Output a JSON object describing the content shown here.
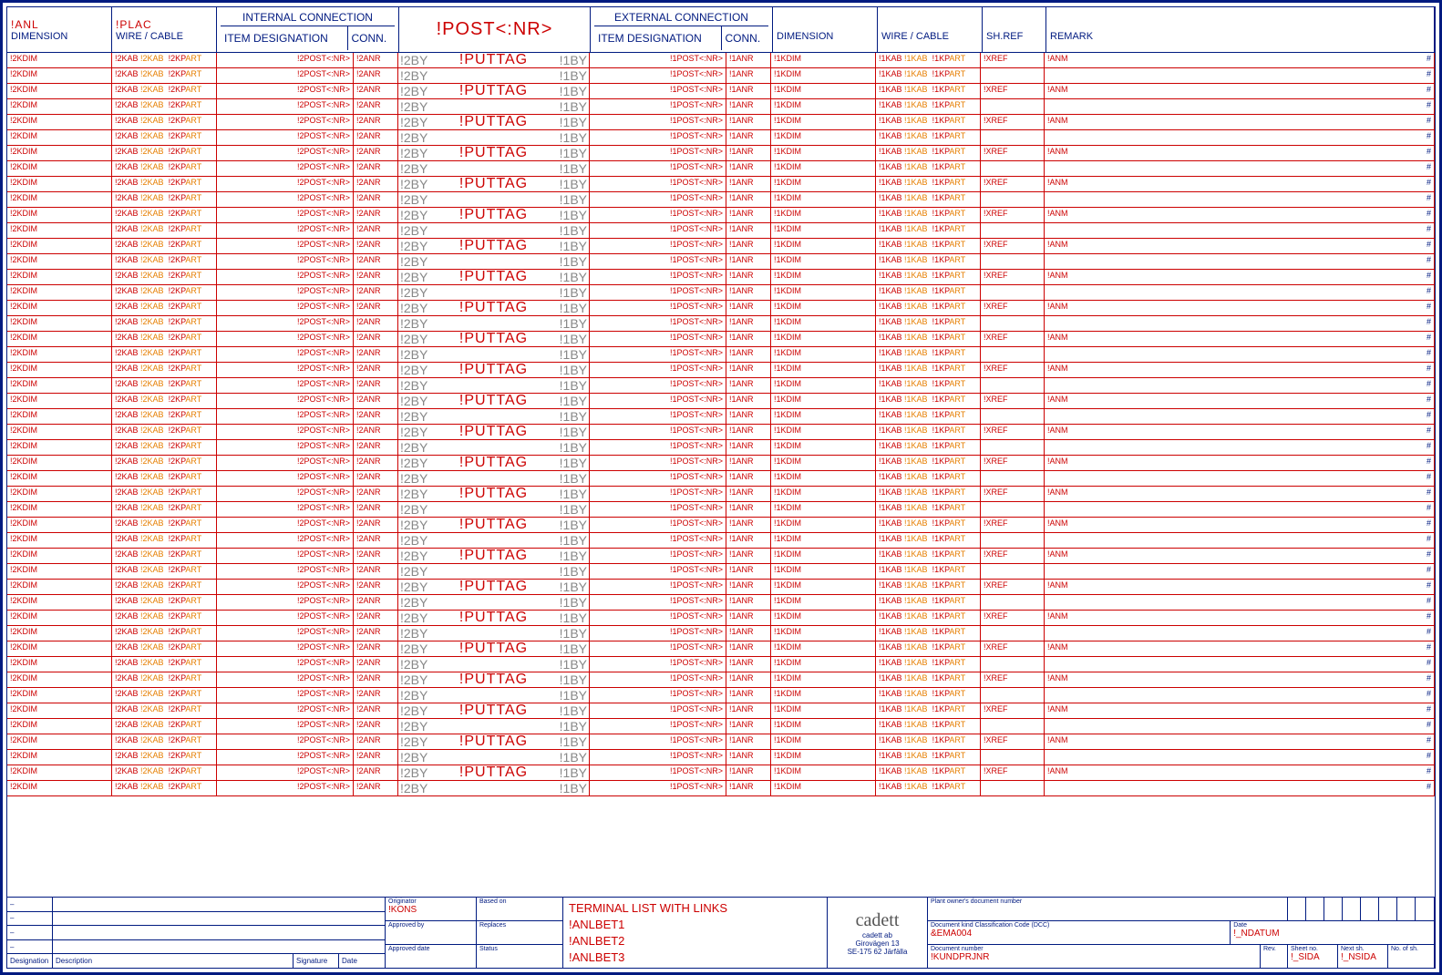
{
  "header": {
    "anl": "!ANL",
    "dimension_l": "DIMENSION",
    "plac": "!PLAC",
    "wire_cable_l": "WIRE / CABLE",
    "internal": "INTERNAL CONNECTION",
    "item_desig_l": "ITEM DESIGNATION",
    "conn_l": "CONN.",
    "post_nr": "!POST<:NR>",
    "external": "EXTERNAL CONNECTION",
    "item_desig_r": "ITEM DESIGNATION",
    "conn_r": "CONN.",
    "dimension_r": "DIMENSION",
    "wire_cable_r": "WIRE / CABLE",
    "shref": "SH.REF",
    "remark": "REMARK"
  },
  "cell": {
    "dim2": "!2KDIM",
    "kab2a": "!2KAB",
    "kab2b": "!2KAB",
    "kpart2": "!2KPART",
    "post2": "!2POST<:NR>",
    "anr2": "!2ANR",
    "by_l": "!2BY",
    "puttag": "!PUTTAG",
    "by_r": "!1BY",
    "post1": "!1POST<:NR>",
    "anr1": "!1ANR",
    "dim1": "!1KDIM",
    "kab1a": "!1KAB",
    "kab1b": "!1KAB",
    "kpart1": "!1KPART",
    "xref": "!XREF",
    "anm": "!ANM",
    "hash": "#"
  },
  "row_count": 48,
  "titleblock": {
    "left_rows": [
      [
        "–"
      ],
      [
        "–"
      ],
      [
        "–"
      ],
      [
        "–"
      ]
    ],
    "left_footer": [
      "Designation",
      "Description",
      "",
      "Signature",
      "Date"
    ],
    "mid1": [
      {
        "lbl": "Originator",
        "val": "!KONS"
      },
      {
        "lbl": "Approved by",
        "val": ""
      },
      {
        "lbl": "Approved date",
        "val": ""
      }
    ],
    "mid2": [
      {
        "lbl": "Based on",
        "val": ""
      },
      {
        "lbl": "Replaces",
        "val": ""
      },
      {
        "lbl": "Status",
        "val": ""
      }
    ],
    "title_lines": [
      "TERMINAL LIST WITH LINKS",
      "!ANLBET1",
      "!ANLBET2",
      "!ANLBET3"
    ],
    "company": {
      "name": "cadett",
      "sub1": "cadett ab",
      "sub2": "Girovägen 13",
      "sub3": "SE-175 62 Järfälla"
    },
    "right": {
      "plant_owner_lbl": "Plant owner's document number",
      "dcc_lbl": "Document kind Classification Code (DCC)",
      "dcc_val": "&EMA004",
      "date_lbl": "Date",
      "date_val": "!_NDATUM",
      "docnum_lbl": "Document number",
      "docnum_val": "!KUNDPRJNR",
      "rev_lbl": "Rev.",
      "sheet_lbl": "Sheet no.",
      "sheet_val": "!_SIDA",
      "next_lbl": "Next sh.",
      "next_val": "!_NSIDA",
      "nof_lbl": "No. of sh."
    }
  }
}
